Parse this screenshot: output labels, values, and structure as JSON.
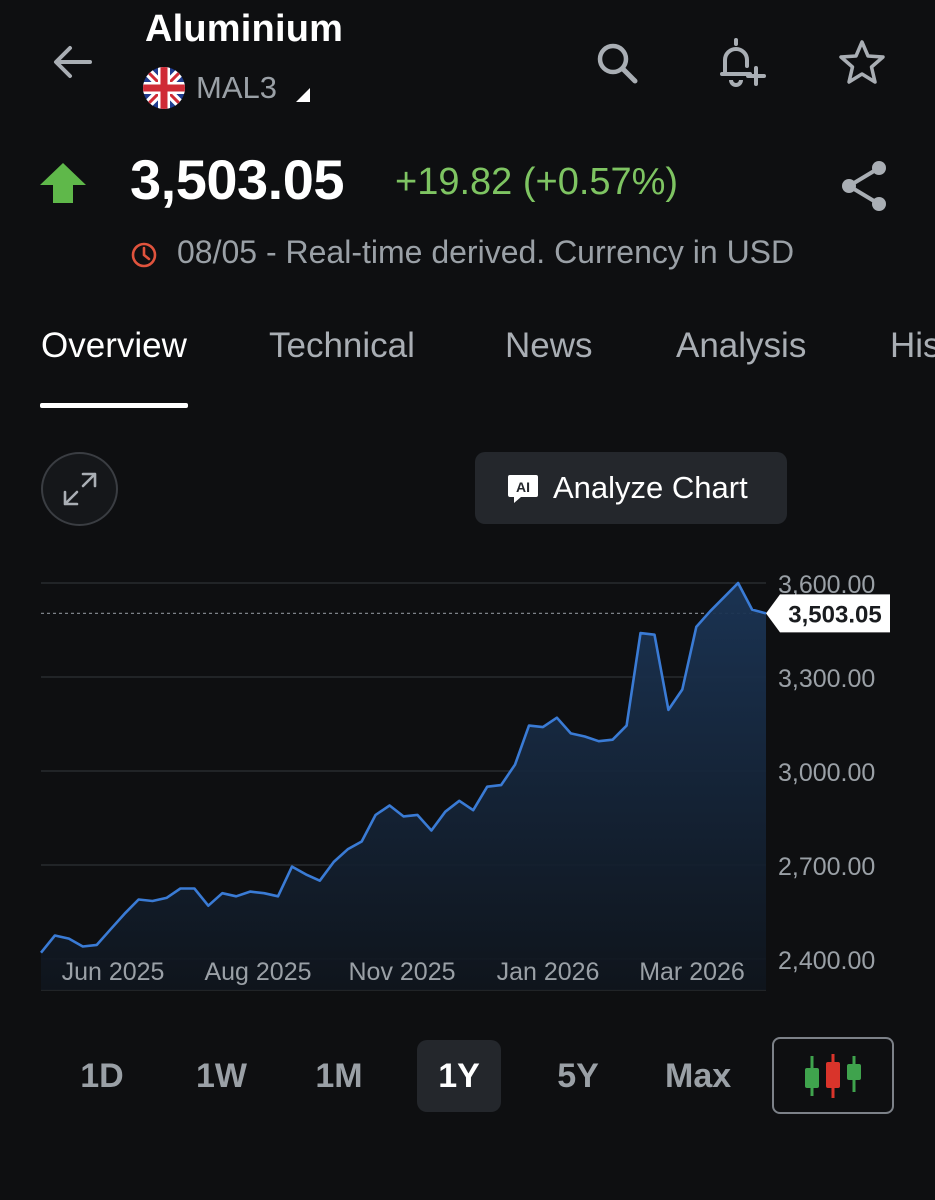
{
  "header": {
    "title": "Aluminium",
    "ticker": "MAL3"
  },
  "quote": {
    "price": "3,503.05",
    "change": "+19.82 (+0.57%)",
    "note": "08/05 - Real-time derived. Currency in USD",
    "direction": "up"
  },
  "tabs": [
    {
      "label": "Overview",
      "active": true
    },
    {
      "label": "Technical",
      "active": false
    },
    {
      "label": "News",
      "active": false
    },
    {
      "label": "Analysis",
      "active": false
    },
    {
      "label": "His",
      "active": false
    }
  ],
  "analyze_button": {
    "label": "Analyze Chart",
    "badge": "AI"
  },
  "ranges": [
    {
      "label": "1D",
      "active": false
    },
    {
      "label": "1W",
      "active": false
    },
    {
      "label": "1M",
      "active": false
    },
    {
      "label": "1Y",
      "active": true
    },
    {
      "label": "5Y",
      "active": false
    },
    {
      "label": "Max",
      "active": false
    }
  ],
  "colors": {
    "background": "#0e0f11",
    "line": "#3a7bd5",
    "positive": "#7ec462",
    "candle_green": "#3fa34d",
    "candle_red": "#d9342b"
  },
  "icons": [
    "back-arrow-icon",
    "uk-flag-icon",
    "search-icon",
    "bell-plus-icon",
    "star-icon",
    "up-arrow-icon",
    "share-icon",
    "clock-icon",
    "expand-icon",
    "ai-icon",
    "candlestick-icon"
  ],
  "chart_data": {
    "type": "area",
    "x_tick_labels": [
      "Jun 2025",
      "Aug 2025",
      "Nov 2025",
      "Jan 2026",
      "Mar 2026"
    ],
    "y_tick_labels": [
      "3,600.00",
      "3,300.00",
      "3,000.00",
      "2,700.00",
      "2,400.00"
    ],
    "y_ticks": [
      3600,
      3300,
      3000,
      2700,
      2400
    ],
    "ylim": [
      2380,
      3610
    ],
    "last_value_label": "3,503.05",
    "last_value": 3503.05,
    "grid": true,
    "series": [
      {
        "values": [
          2420,
          2475,
          2465,
          2440,
          2445,
          2495,
          2545,
          2590,
          2585,
          2595,
          2625,
          2625,
          2570,
          2610,
          2600,
          2615,
          2610,
          2600,
          2695,
          2670,
          2650,
          2710,
          2750,
          2775,
          2860,
          2890,
          2855,
          2860,
          2810,
          2870,
          2905,
          2875,
          2950,
          2955,
          3020,
          3145,
          3140,
          3170,
          3120,
          3110,
          3095,
          3100,
          3145,
          3440,
          3435,
          3195,
          3260,
          3460,
          3510,
          3555,
          3600,
          3515,
          3503.05
        ]
      }
    ]
  }
}
